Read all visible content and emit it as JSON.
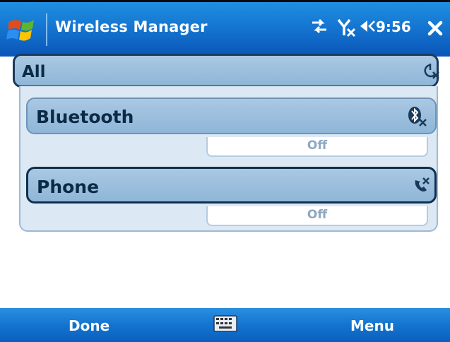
{
  "titlebar": {
    "app_title": "Wireless Manager",
    "clock": "9:56",
    "icons": [
      "windows-start-icon",
      "connectivity-icon",
      "signal-off-icon",
      "speaker-icon",
      "close-icon"
    ]
  },
  "all": {
    "label": "All",
    "icon": "all-wireless-off-icon"
  },
  "items": [
    {
      "label": "Bluetooth",
      "status": "Off",
      "icon": "bluetooth-off-icon"
    },
    {
      "label": "Phone",
      "status": "Off",
      "icon": "phone-off-icon"
    }
  ],
  "softkeys": {
    "left": "Done",
    "right": "Menu",
    "center_icon": "keyboard-icon"
  }
}
